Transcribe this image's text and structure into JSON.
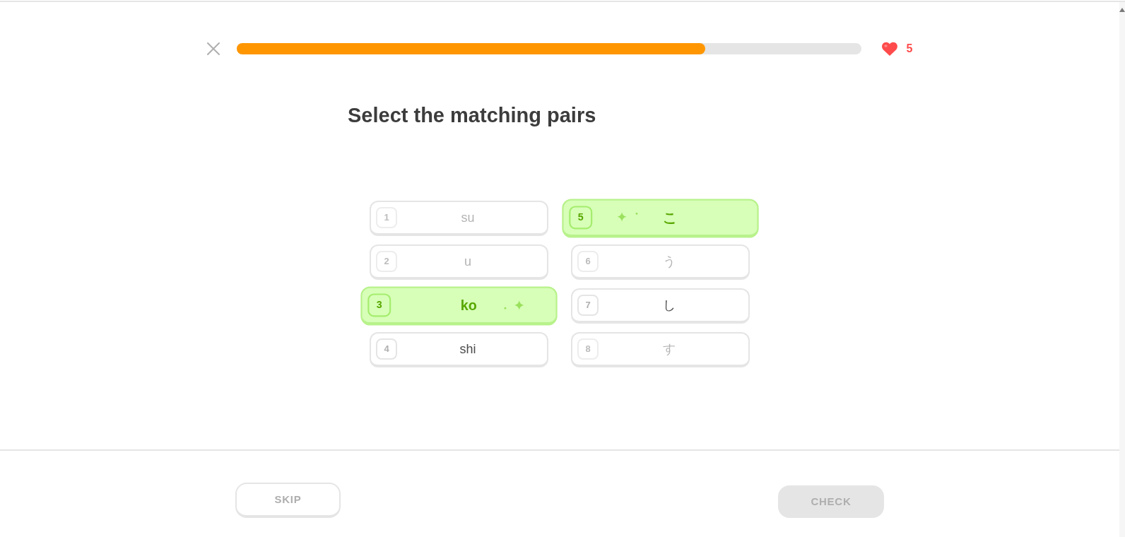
{
  "lesson": {
    "progress": {
      "level": 0.75
    },
    "hearts": "5"
  },
  "title": "Select the matching pairs",
  "pairs": {
    "left": [
      {
        "number": "1",
        "text": "su",
        "disabled": true,
        "correct": false
      },
      {
        "number": "2",
        "text": "u",
        "disabled": true,
        "correct": false
      },
      {
        "number": "3",
        "text": "ko",
        "disabled": false,
        "correct": true
      },
      {
        "number": "4",
        "text": "shi",
        "disabled": false,
        "correct": false
      }
    ],
    "right": [
      {
        "number": "5",
        "text": "こ",
        "disabled": false,
        "correct": true
      },
      {
        "number": "6",
        "text": "う",
        "disabled": true,
        "correct": false
      },
      {
        "number": "7",
        "text": "し",
        "disabled": false,
        "correct": false
      },
      {
        "number": "8",
        "text": "す",
        "disabled": true,
        "correct": false
      }
    ]
  },
  "footer": {
    "skip": "SKIP",
    "check": {
      "label": "CHECK",
      "disabled": true
    }
  }
}
